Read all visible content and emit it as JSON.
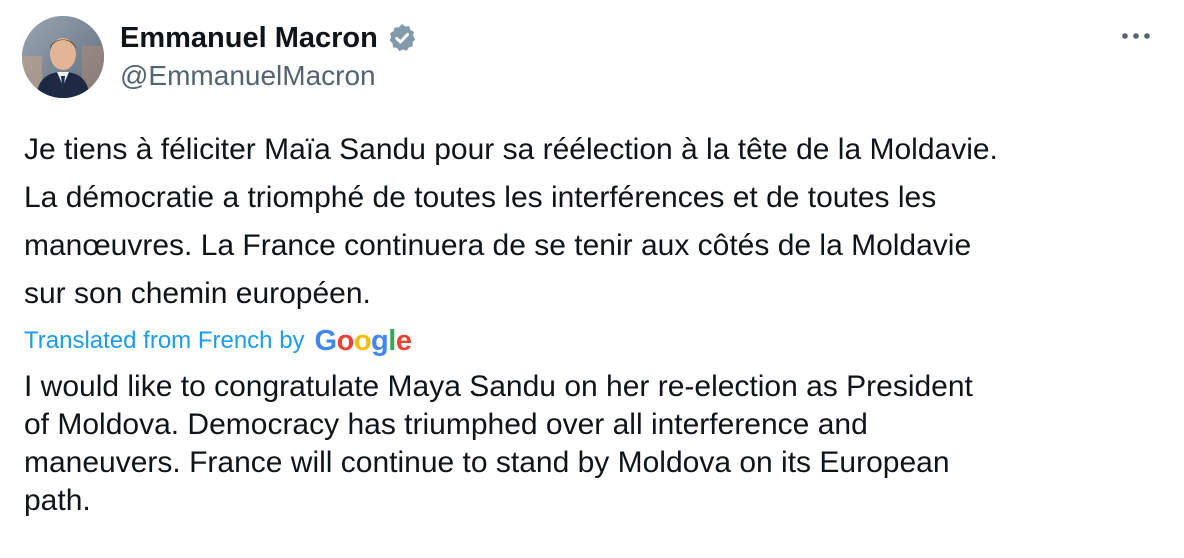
{
  "author": {
    "display_name": "Emmanuel Macron",
    "handle": "@EmmanuelMacron",
    "verified": true,
    "avatar_icon": "profile-photo",
    "verified_icon": "verified-badge-icon"
  },
  "more_menu": {
    "label": "•••",
    "icon": "more-options-icon"
  },
  "tweet": {
    "original_lines": [
      "Je tiens à féliciter Maïa Sandu pour sa réélection à la tête de la Moldavie.",
      "La démocratie a triomphé de toutes les interférences et de toutes les",
      "manœuvres. La France continuera de se tenir aux côtés de la Moldavie",
      "sur son chemin européen."
    ],
    "translation_note": "Translated from French by",
    "translation_provider": {
      "letters": [
        "G",
        "o",
        "o",
        "g",
        "l",
        "e"
      ]
    },
    "translated_lines": [
      "I would like to congratulate Maya Sandu on her re-election as President",
      "of Moldova. Democracy has triumphed over all interference and",
      "maneuvers. France will continue to stand by Moldova on its European",
      "path."
    ]
  },
  "colors": {
    "text": "#0f1419",
    "secondary": "#536471",
    "link": "#1d9bf0",
    "verified_badge": "#829aab"
  }
}
